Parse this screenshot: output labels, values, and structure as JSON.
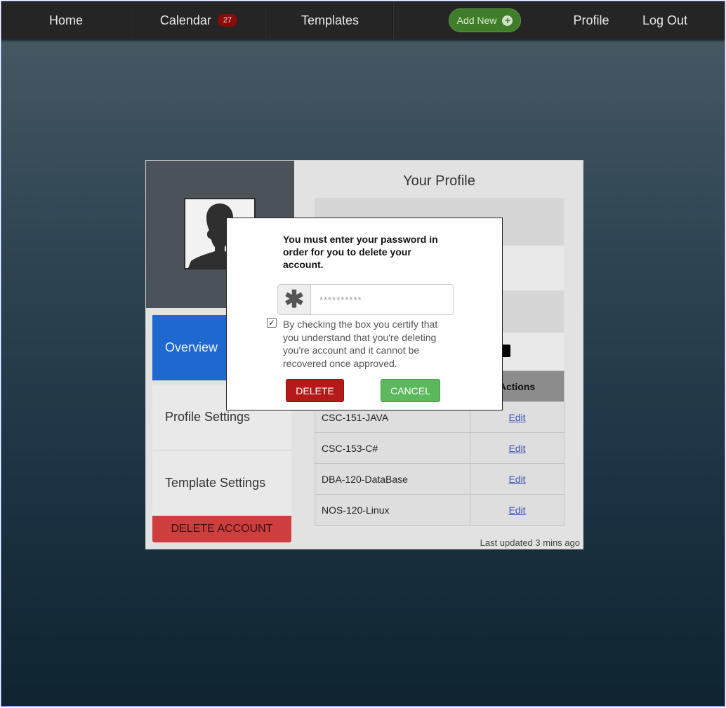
{
  "nav": {
    "home": "Home",
    "calendar": "Calendar",
    "calendar_badge": "27",
    "templates": "Templates",
    "add_new": "Add New",
    "profile": "Profile",
    "logout": "Log Out"
  },
  "sidebar": {
    "items": [
      {
        "label": "Overview",
        "active": true
      },
      {
        "label": "Profile Settings",
        "active": false
      },
      {
        "label": "Template Settings",
        "active": false
      }
    ],
    "delete_account": "DELETE ACCOUNT"
  },
  "profile": {
    "title": "Your Profile",
    "table": {
      "header_actions": "Actions",
      "rows": [
        {
          "name": "CSC-151-JAVA",
          "action": "Edit"
        },
        {
          "name": "CSC-153-C#",
          "action": "Edit"
        },
        {
          "name": "DBA-120-DataBase",
          "action": "Edit"
        },
        {
          "name": "NOS-120-Linux",
          "action": "Edit"
        }
      ]
    },
    "last_updated": "Last updated 3 mins ago"
  },
  "modal": {
    "message": "You must enter your password in order for you to delete your account.",
    "password_placeholder": "**********",
    "password_value": "",
    "checkbox_checked": true,
    "checkbox_text": "By checking the box you certify that you understand that you're deleting you're account and it cannot be recovered once approved.",
    "delete_label": "DELETE",
    "cancel_label": "CANCEL"
  },
  "icons": {
    "add_new": "plus-circle-icon",
    "password": "asterisk-icon",
    "avatar": "user-silhouette-icon"
  },
  "colors": {
    "nav_bg": "#252525",
    "active_tab": "#1f68cf",
    "delete_account": "#cf3e3e",
    "delete_button": "#b51a1a",
    "cancel_button": "#5cb85c",
    "add_new": "#3f7d2a",
    "badge": "#8b0b0b"
  }
}
